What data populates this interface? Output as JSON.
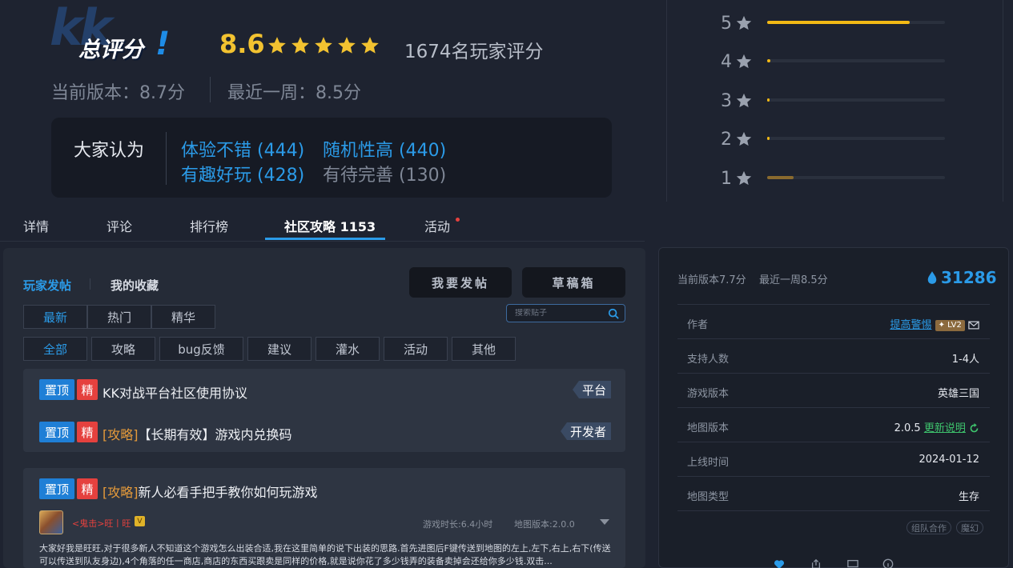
{
  "rating": {
    "logo_kk": "kk",
    "logo_text": "总评分",
    "logo_bang": "!",
    "score": "8.6",
    "raters": "1674名玩家评分",
    "current_version": "当前版本：8.7分",
    "recent_week": "最近一周：8.5分",
    "opinion_title": "大家认为",
    "tags": [
      "体验不错 (444)",
      "随机性高 (440)",
      "有趣好玩 (428)",
      "有待完善 (130)"
    ],
    "distribution": [
      {
        "label": "5",
        "fraction": 0.8
      },
      {
        "label": "4",
        "fraction": 0.02
      },
      {
        "label": "3",
        "fraction": 0.01
      },
      {
        "label": "2",
        "fraction": 0.01
      },
      {
        "label": "1",
        "fraction": 0.15
      }
    ],
    "colors": {
      "accent": "#f2c230",
      "bar": "#f2b915",
      "bar_low": "#8a6a2e"
    }
  },
  "tabs": [
    {
      "label": "详情"
    },
    {
      "label": "评论"
    },
    {
      "label": "排行榜"
    },
    {
      "label": "社区攻略 1153"
    },
    {
      "label": "活动"
    }
  ],
  "community": {
    "sub_tabs": [
      "玩家发帖",
      "我的收藏"
    ],
    "post_button": "我要发帖",
    "draft_button": "草稿箱",
    "search_placeholder": "搜索贴子",
    "sort": [
      "最新",
      "热门",
      "精华"
    ],
    "categories": [
      "全部",
      "攻略",
      "bug反馈",
      "建议",
      "灌水",
      "活动",
      "其他"
    ],
    "badge_top": "置顶",
    "badge_jing": "精",
    "pinned": [
      {
        "prefix": "",
        "title": "KK对战平台社区使用协议",
        "tag": "平台"
      },
      {
        "prefix": "[攻略]",
        "title": "【长期有效】游戏内兑换码",
        "tag": "开发者"
      }
    ],
    "post": {
      "prefix": "[攻略]",
      "title": "新人必看手把手教你如何玩游戏",
      "author": "<鬼击>旺丨旺",
      "vip": "V",
      "play_time": "游戏时长:6.4小时",
      "map_version": "地图版本:2.0.0",
      "body": "大家好我是旺旺,对于很多新人不知道这个游戏怎么出装合适,我在这里简单的说下出装的思路.首先进图后F键传送到地图的左上,左下,右上,右下(传送可以传送到队友身边),4个角落的任一商店,商店的东西买跟卖是同样的价格,就是说你花了多少钱弄的装备卖掉会还给你多少钱.双击..."
    }
  },
  "info": {
    "current_version": "当前版本7.7分",
    "recent_week": "最近一周8.5分",
    "hot": "31286",
    "rows": [
      {
        "label": "作者",
        "value": "提高警惕",
        "level": "LV2"
      },
      {
        "label": "支持人数",
        "value": "1-4人"
      },
      {
        "label": "游戏版本",
        "value": "英雄三国"
      },
      {
        "label": "地图版本",
        "value": "2.0.5",
        "link": "更新说明"
      },
      {
        "label": "上线时间",
        "value": "2024-01-12"
      },
      {
        "label": "地图类型",
        "value": "生存"
      }
    ],
    "chips": [
      "组队合作",
      "魔幻"
    ]
  }
}
